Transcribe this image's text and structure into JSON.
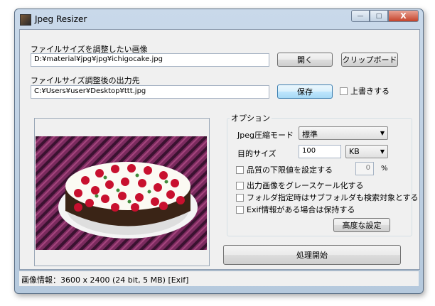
{
  "window": {
    "title": "Jpeg Resizer",
    "icon": "app-icon"
  },
  "titlebar_buttons": {
    "minimize": "—",
    "maximize": "□",
    "close": "X"
  },
  "input_section": {
    "label": "ファイルサイズを調整したい画像",
    "value": "D:¥material¥jpg¥jpg¥ichigocake.jpg",
    "open_button": "開く",
    "clipboard_button": "クリップボード"
  },
  "output_section": {
    "label": "ファイルサイズ調整後の出力先",
    "value": "C:¥Users¥user¥Desktop¥ttt.jpg",
    "save_button": "保存",
    "overwrite_label": "上書きする"
  },
  "options": {
    "title": "オプション",
    "compression_label": "Jpeg圧縮モード",
    "compression_value": "標準",
    "target_size_label": "目的サイズ",
    "target_size_value": "100",
    "unit_value": "KB",
    "quality_min_label": "品質の下限値を設定する",
    "quality_min_value": "0",
    "quality_unit": "%",
    "grayscale_label": "出力画像をグレースケール化する",
    "subfolder_label": "フォルダ指定時はサブフォルダも検索対象とする",
    "exif_label": "Exif情報がある場合は保持する",
    "advanced_button": "高度な設定"
  },
  "process_button": "処理開始",
  "status": "画像情報：3600 x 2400 (24 bit, 5 MB) [Exif]"
}
